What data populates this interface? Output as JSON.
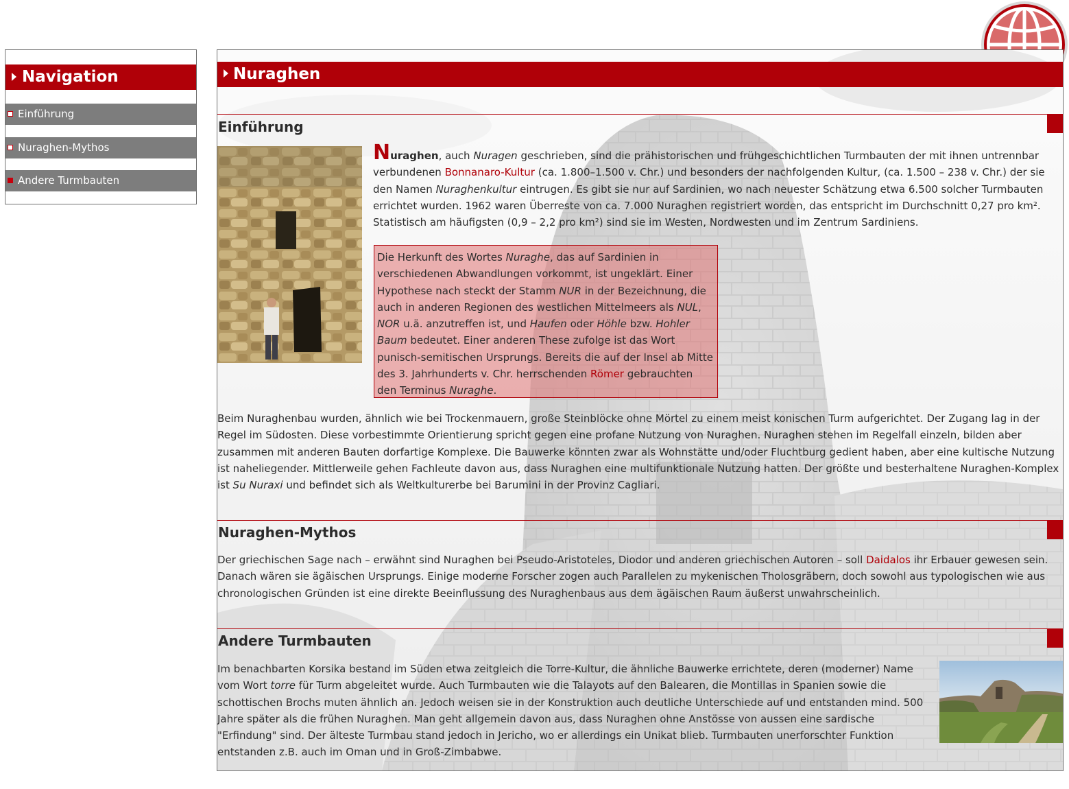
{
  "nav": {
    "title": "Navigation",
    "items": [
      {
        "label": "Einführung"
      },
      {
        "label": "Nuraghen-Mythos"
      },
      {
        "label": "Andere Turmbauten"
      }
    ]
  },
  "main": {
    "title": "Nuraghen",
    "sections": [
      {
        "title": "Einführung",
        "p1": {
          "dropcap": "N",
          "t1": "uraghen",
          "t2": ", auch ",
          "t3": "Nuragen",
          "t4": " geschrieben, sind die prähistorischen und frühgeschichtlichen Turmbauten der mit ihnen untrennbar verbundenen ",
          "link1": "Bonnanaro-Kultur",
          "t5": " (ca. 1.800–1.500 v. Chr.) und besonders der nachfolgenden Kultur, (ca. 1.500 – 238 v. Chr.) der sie den Namen ",
          "t6": "Nuraghenkultur",
          "t7": " eintrugen. Es gibt sie nur auf Sardinien, wo nach neuester Schätzung etwa 6.500 solcher Turmbauten errichtet wurden. 1962 waren Überreste von ca. 7.000 Nuraghen registriert worden, das entspricht im Durchschnitt 0,27 pro km². Statistisch am häufigsten (0,9 – 2,2 pro km²) sind sie im Westen, Nordwesten und im Zentrum Sardiniens."
        },
        "quote": {
          "t1": "Die Herkunft des Wortes ",
          "t2": "Nuraghe",
          "t3": ", das auf Sardinien in verschiedenen Abwandlungen vorkommt, ist ungeklärt. Einer Hypothese nach steckt der Stamm ",
          "t4": "NUR",
          "t5": " in der Bezeichnung, die auch in anderen Regionen des westlichen Mittelmeers als ",
          "t6": "NUL",
          "t7": ", ",
          "t8": "NOR",
          "t9": " u.ä. anzutreffen ist, und ",
          "t10": "Haufen",
          "t11": " oder ",
          "t12": "Höhle",
          "t13": " bzw. ",
          "t14": "Hohler Baum",
          "t15": " bedeutet. Einer anderen These zufolge ist das Wort punisch-semitischen Ursprungs. Bereits die auf der Insel ab Mitte des 3. Jahrhunderts v. Chr. herrschenden ",
          "link": "Römer",
          "t16": " gebrauchten den Terminus ",
          "t17": "Nuraghe",
          "t18": "."
        },
        "p2": {
          "t1": "Beim Nuraghenbau wurden, ähnlich wie bei Trockenmauern, große Steinblöcke ohne Mörtel zu einem meist konischen Turm aufgerichtet. Der Zugang lag in der Regel im Südosten. Diese vorbestimmte Orientierung spricht gegen eine profane Nutzung von Nuraghen. Nuraghen stehen im Regelfall einzeln, bilden aber zusammen mit anderen Bauten dorfartige Komplexe. Die Bauwerke könnten zwar als Wohnstätte und/oder Fluchtburg gedient haben, aber eine kultische Nutzung ist naheliegender. Mittlerweile gehen Fachleute davon aus, dass Nuraghen eine multifunktionale Nutzung hatten. Der größte und besterhaltene Nuraghen-Komplex ist ",
          "t2": "Su Nuraxi",
          "t3": " und befindet sich als Weltkulturerbe bei Barumini in der Provinz Cagliari."
        }
      },
      {
        "title": "Nuraghen-Mythos",
        "p1": {
          "t1": "Der griechischen Sage nach – erwähnt sind Nuraghen bei Pseudo-Aristoteles, Diodor und anderen griechischen Autoren – soll ",
          "link": "Daidalos",
          "t2": " ihr Erbauer gewesen sein. Danach wären sie ägäischen Ursprungs. Einige moderne Forscher zogen auch Parallelen zu mykenischen Tholosgräbern, doch sowohl aus typologischen wie aus chronologischen Gründen ist eine direkte Beeinflussung des Nuraghenbaus aus dem ägäischen Raum äußerst unwahrscheinlich."
        }
      },
      {
        "title": "Andere Turmbauten",
        "p1": {
          "t1": "Im benachbarten Korsika bestand im Süden etwa zeitgleich die Torre-Kultur, die ähnliche Bauwerke errichtete, deren (moderner) Name vom Wort ",
          "t2": "torre",
          "t3": " für Turm abgeleitet wurde. Auch Turmbauten wie die Talayots auf den Balearen, die Montillas in Spanien sowie die schottischen Brochs muten ähnlich an. Jedoch weisen sie in der Konstruktion auch deutliche Unterschiede auf und entstanden mind. 500 Jahre später als die frühen Nuraghen. Man geht allgemein davon aus, dass Nuraghen ohne Anstösse von aussen eine sardische \"Erfindung\" sind. Der älteste Turmbau stand jedoch in Jericho, wo er allerdings ein Unikat blieb. Turmbauten unerforschter Funktion entstanden z.B. auch im Oman und in Groß-Zimbabwe."
        }
      }
    ]
  },
  "colors": {
    "accent": "#b00008",
    "nav_item_bg": "#7d7d7d",
    "quote_bg": "#e07474"
  },
  "icons": {
    "globe": "globe-icon",
    "triangle": "triangle-right-icon",
    "bullet": "square-bullet-icon"
  }
}
